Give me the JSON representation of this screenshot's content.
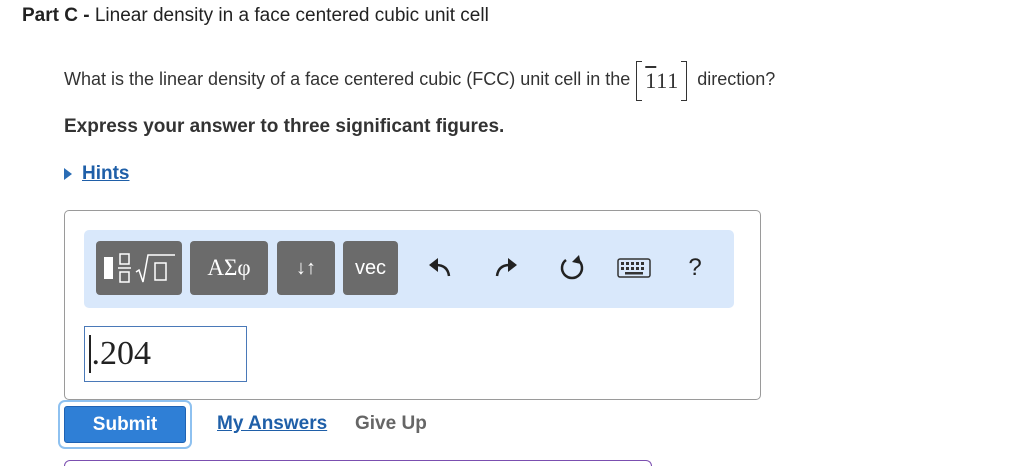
{
  "part": {
    "label": "Part C",
    "separator": " - ",
    "title": "Linear density in a face centered cubic unit cell"
  },
  "question": {
    "text": "What is the linear density of a face centered cubic (FCC) unit cell in the",
    "direction": {
      "h_bar": "1",
      "k": "1",
      "l": "1"
    },
    "suffix": "direction?"
  },
  "instruction": "Express your answer to three significant figures.",
  "hints": {
    "label": "Hints"
  },
  "toolbar": {
    "templates_icon": "fraction-sqrt-icon",
    "greek_label": "ΑΣφ",
    "arrows_label": "↓↑",
    "vec_label": "vec",
    "undo_icon": "undo-arrow-icon",
    "redo_icon": "redo-arrow-icon",
    "reset_icon": "reset-icon",
    "keyboard_icon": "keyboard-icon",
    "help_label": "?"
  },
  "answer": {
    "value": ".204"
  },
  "actions": {
    "submit": "Submit",
    "my_answers": "My Answers",
    "give_up": "Give Up"
  },
  "colors": {
    "link": "#1f5fa8",
    "submit": "#2f7fd6",
    "toolbar_bg": "#d9e8fb",
    "toolbar_button": "#6b6b6b"
  }
}
